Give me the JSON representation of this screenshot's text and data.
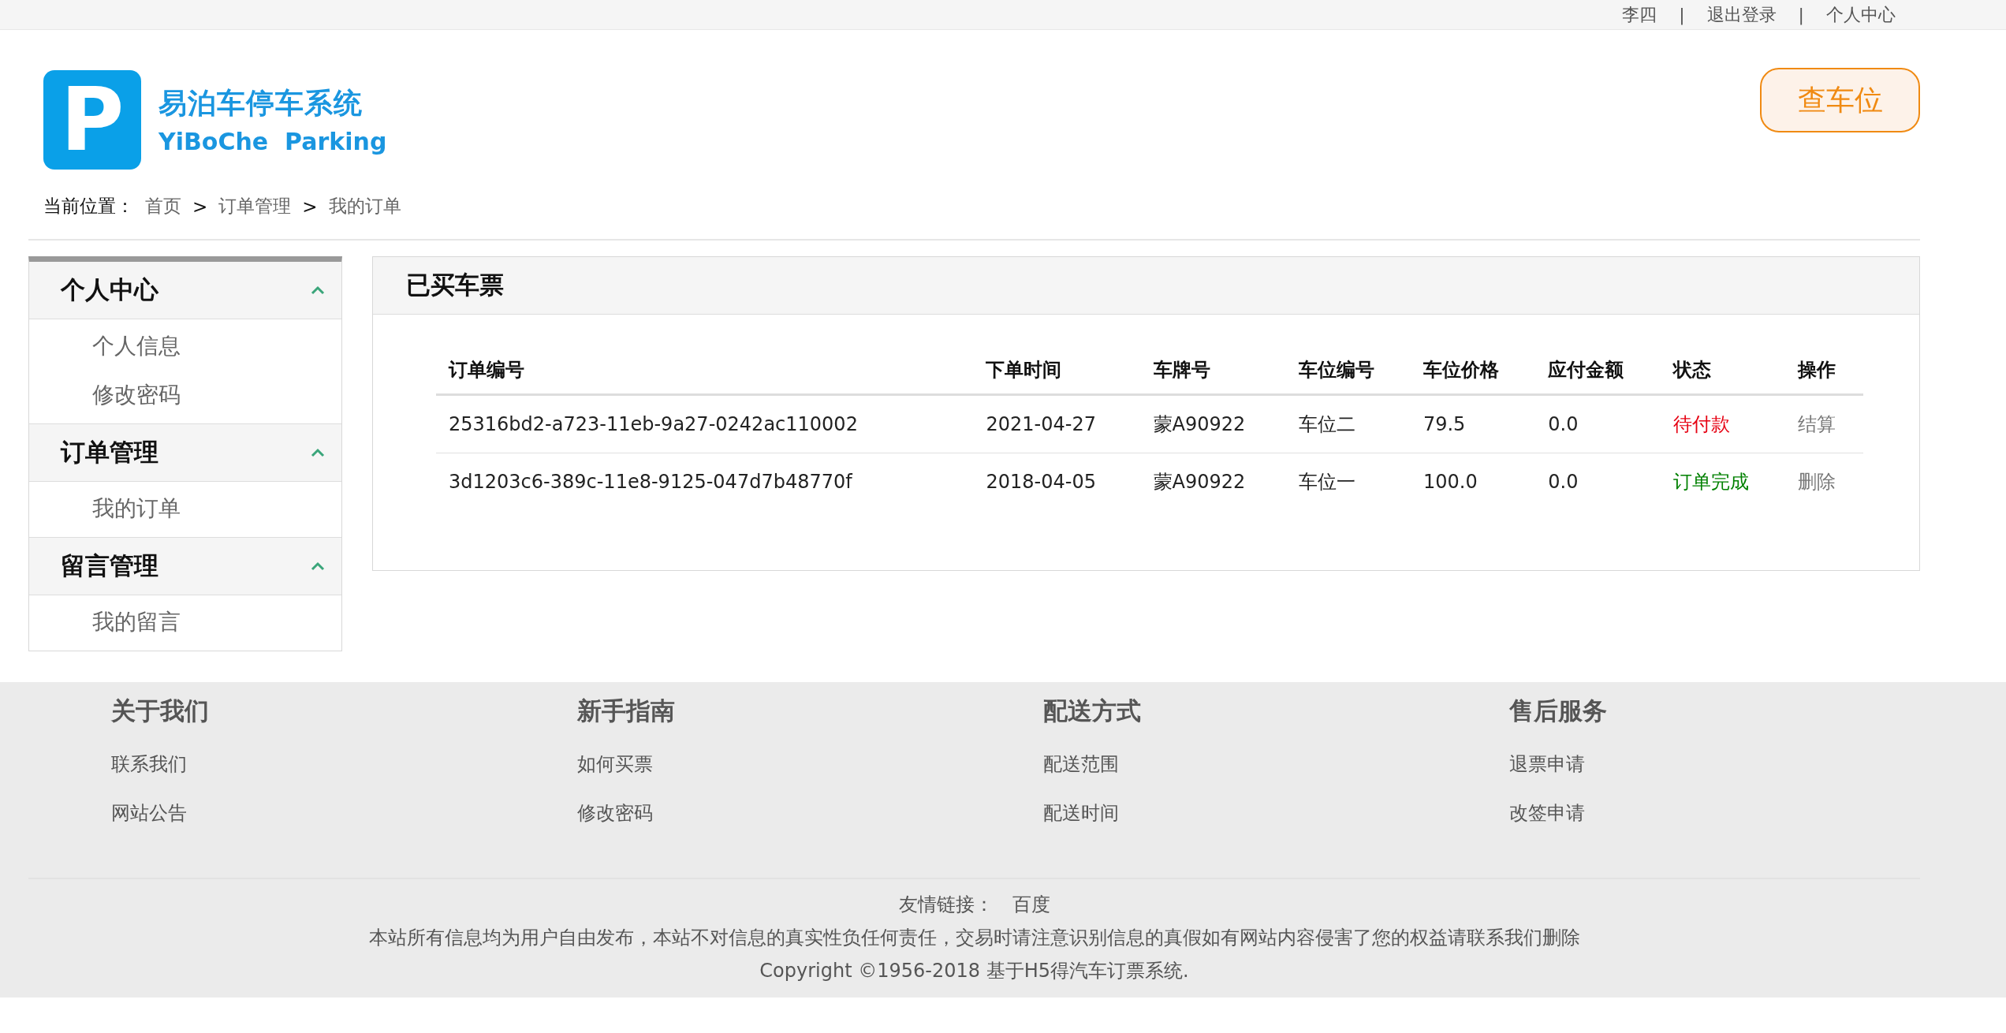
{
  "top_bar": {
    "links": [
      "李四",
      "退出登录",
      "个人中心"
    ],
    "separator": "|"
  },
  "logo": {
    "mark": "P",
    "title": "易泊车停车系统",
    "subtitle": "YiBoChe  Parking"
  },
  "search_button": "查车位",
  "breadcrumb": {
    "label": "当前位置：",
    "separator": ">",
    "items": [
      "首页",
      "订单管理",
      "我的订单"
    ]
  },
  "sidebar": {
    "sections": [
      {
        "title": "个人中心",
        "expanded": true,
        "items": [
          "个人信息",
          "修改密码"
        ]
      },
      {
        "title": "订单管理",
        "expanded": true,
        "items": [
          "我的订单"
        ]
      },
      {
        "title": "留言管理",
        "expanded": true,
        "items": [
          "我的留言"
        ]
      }
    ]
  },
  "panel": {
    "title": "已买车票",
    "table": {
      "columns": [
        "订单编号",
        "下单时间",
        "车牌号",
        "车位编号",
        "车位价格",
        "应付金额",
        "状态",
        "操作"
      ],
      "rows": [
        {
          "cells": [
            "25316bd2-a723-11eb-9a27-0242ac110002",
            "2021-04-27",
            "蒙A90922",
            "车位二",
            "79.5",
            "0.0"
          ],
          "status": {
            "text": "待付款",
            "color": "#e60012"
          },
          "action": "结算"
        },
        {
          "cells": [
            "3d1203c6-389c-11e8-9125-047d7b48770f",
            "2018-04-05",
            "蒙A90922",
            "车位一",
            "100.0",
            "0.0"
          ],
          "status": {
            "text": "订单完成",
            "color": "#008000"
          },
          "action": "删除"
        }
      ]
    }
  },
  "footer": {
    "columns": [
      {
        "title": "关于我们",
        "links": [
          "联系我们",
          "网站公告"
        ]
      },
      {
        "title": "新手指南",
        "links": [
          "如何买票",
          "修改密码"
        ]
      },
      {
        "title": "配送方式",
        "links": [
          "配送范围",
          "配送时间"
        ]
      },
      {
        "title": "售后服务",
        "links": [
          "退票申请",
          "改签申请"
        ]
      }
    ],
    "friend_links": {
      "label": "友情链接：",
      "links": [
        "百度"
      ]
    },
    "disclaimer": "本站所有信息均为用户自由发布，本站不对信息的真实性负任何责任，交易时请注意识别信息的真假如有网站内容侵害了您的权益请联系我们删除",
    "copyright": "Copyright ©1956-2018 基于H5得汽车订票系统."
  }
}
